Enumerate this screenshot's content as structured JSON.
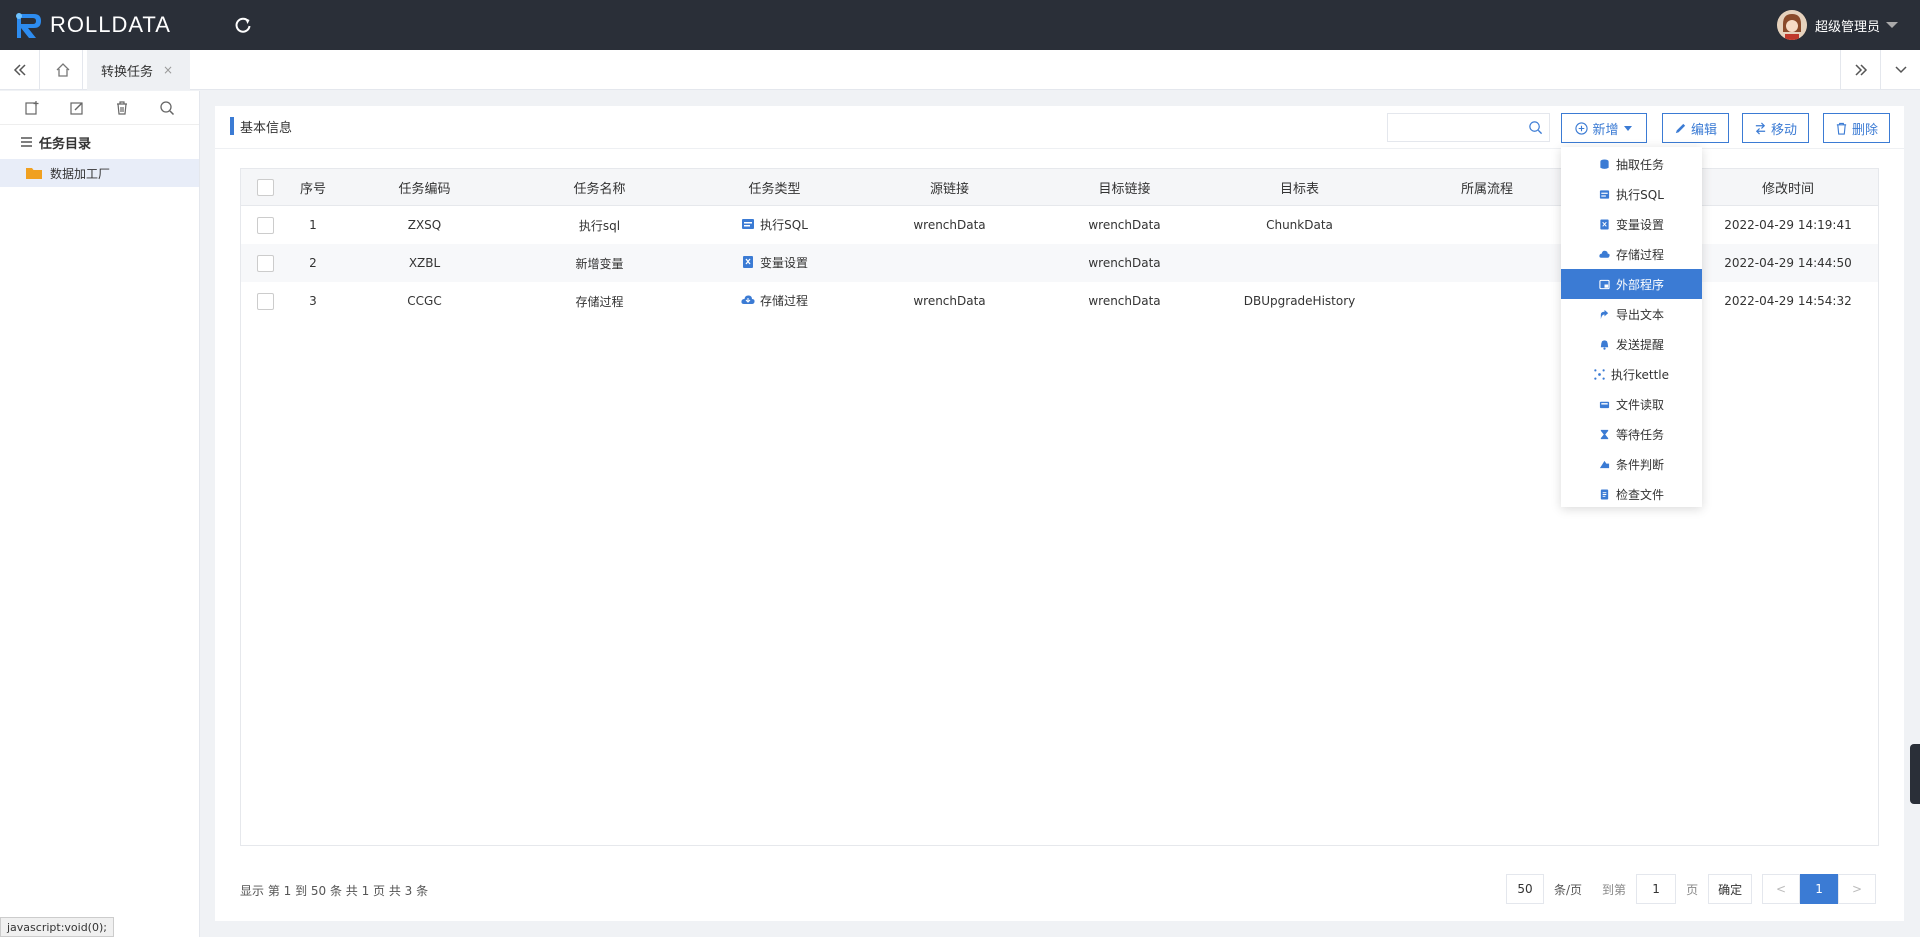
{
  "brand": {
    "name": "ROLLDATA"
  },
  "user": {
    "name": "超级管理员"
  },
  "tabs": [
    {
      "label": "转换任务",
      "close": "×"
    }
  ],
  "sidebar": {
    "tree_title": "任务目录",
    "folder": "数据加工厂"
  },
  "panel": {
    "title": "基本信息",
    "search_placeholder": "",
    "buttons": {
      "add": "新增",
      "edit": "编辑",
      "move": "移动",
      "delete": "删除"
    }
  },
  "table": {
    "headers": [
      "序号",
      "任务编码",
      "任务名称",
      "任务类型",
      "源链接",
      "目标链接",
      "目标表",
      "所属流程",
      "修改时间"
    ],
    "rows": [
      {
        "no": "1",
        "code": "ZXSQ",
        "name": "执行sql",
        "type": "执行SQL",
        "type_icon": "sql-icon",
        "src": "wrenchData",
        "dst": "wrenchData",
        "table": "ChunkData",
        "flow": "",
        "time": "2022-04-29 14:19:41"
      },
      {
        "no": "2",
        "code": "XZBL",
        "name": "新增变量",
        "type": "变量设置",
        "type_icon": "variable-icon",
        "src": "",
        "dst": "wrenchData",
        "table": "",
        "flow": "",
        "time": "2022-04-29 14:44:50"
      },
      {
        "no": "3",
        "code": "CCGC",
        "name": "存储过程",
        "type": "存储过程",
        "type_icon": "cloud-icon",
        "src": "wrenchData",
        "dst": "wrenchData",
        "table": "DBUpgradeHistory",
        "flow": "",
        "time": "2022-04-29 14:54:32"
      }
    ]
  },
  "dropdown": {
    "items": [
      {
        "label": "抽取任务",
        "icon": "database-icon"
      },
      {
        "label": "执行SQL",
        "icon": "sql-icon"
      },
      {
        "label": "变量设置",
        "icon": "variable-icon"
      },
      {
        "label": "存储过程",
        "icon": "cloud-icon"
      },
      {
        "label": "外部程序",
        "icon": "window-icon",
        "active": true
      },
      {
        "label": "导出文本",
        "icon": "export-icon"
      },
      {
        "label": "发送提醒",
        "icon": "bell-icon"
      },
      {
        "label": "执行kettle",
        "icon": "kettle-icon"
      },
      {
        "label": "文件读取",
        "icon": "file-read-icon"
      },
      {
        "label": "等待任务",
        "icon": "hourglass-icon"
      },
      {
        "label": "条件判断",
        "icon": "condition-icon"
      },
      {
        "label": "检查文件",
        "icon": "check-file-icon"
      }
    ]
  },
  "footer": {
    "info": "显示 第 1 到 50 条 共 1 页 共 3 条",
    "page_size": "50",
    "per_page": "条/页",
    "goto": "到第",
    "goto_value": "1",
    "page_unit": "页",
    "confirm": "确定",
    "prev": "<",
    "current": "1",
    "next": ">"
  },
  "status_bar": "javascript:void(0);",
  "colors": {
    "primary": "#3b7bd4",
    "topbar": "#2a2f38"
  }
}
